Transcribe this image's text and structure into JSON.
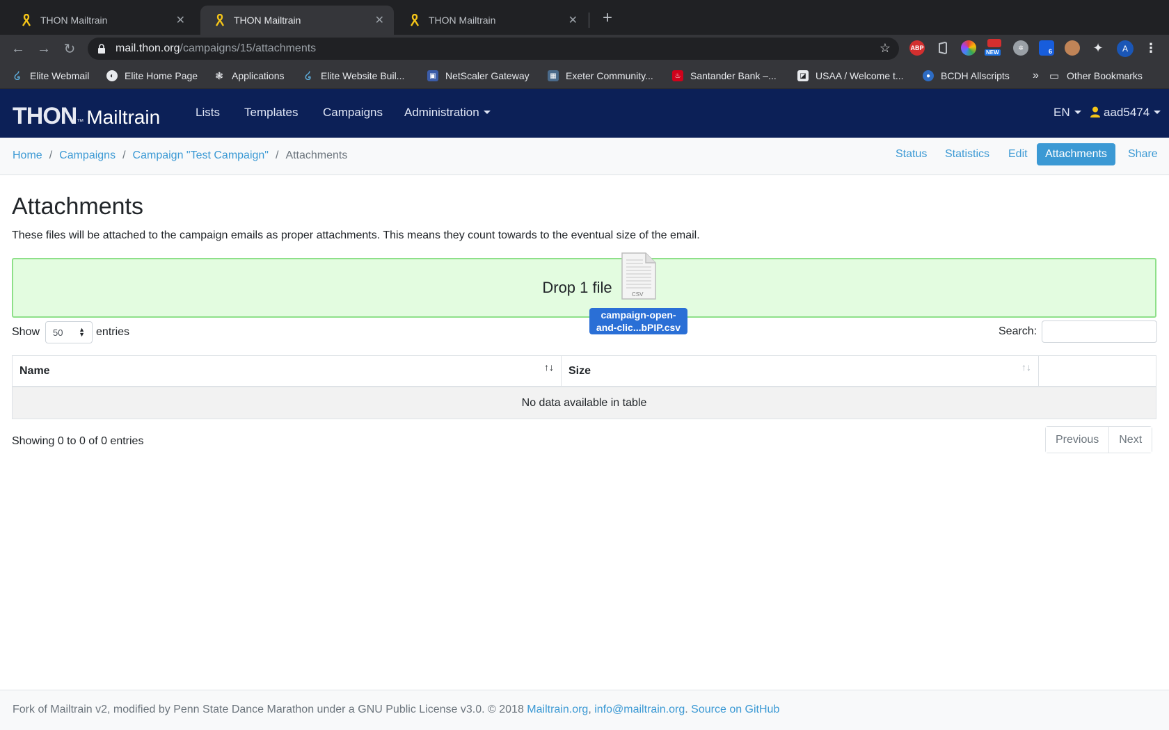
{
  "browser": {
    "tabs": [
      {
        "title": "THON Mailtrain",
        "active": false
      },
      {
        "title": "THON Mailtrain",
        "active": true
      },
      {
        "title": "THON Mailtrain",
        "active": false
      }
    ],
    "url_host": "mail.thon.org",
    "url_path": "/campaigns/15/attachments",
    "extensions": [
      "adblock-icon",
      "office-icon",
      "color-wheel-icon",
      "new-badge-icon",
      "gear-extension-icon",
      "bitwarden-icon",
      "cookie-icon",
      "puzzle-icon",
      "profile-avatar"
    ],
    "extension_badges": {
      "new": "NEW",
      "count": "6",
      "avatar": "A"
    },
    "bookmarks": [
      {
        "label": "Elite Webmail",
        "icon": "swirl-icon"
      },
      {
        "label": "Elite Home Page",
        "icon": "globe-icon"
      },
      {
        "label": "Applications",
        "icon": "brain-icon"
      },
      {
        "label": "Elite Website Buil...",
        "icon": "swirl-icon"
      },
      {
        "label": "NetScaler Gateway",
        "icon": "lock-icon"
      },
      {
        "label": "Exeter Community...",
        "icon": "building-icon"
      },
      {
        "label": "Santander Bank –...",
        "icon": "flame-icon"
      },
      {
        "label": "USAA / Welcome t...",
        "icon": "usaa-icon"
      },
      {
        "label": "BCDH Allscripts",
        "icon": "dell-icon"
      }
    ],
    "bookmarks_overflow": "»",
    "other_bookmarks": "Other Bookmarks"
  },
  "app": {
    "brand_thon": "THON",
    "brand_tm": "™",
    "brand_mailtrain": "Mailtrain",
    "nav": [
      "Lists",
      "Templates",
      "Campaigns",
      "Administration"
    ],
    "language": "EN",
    "user": "aad5474",
    "colors": {
      "navbar": "#0c2057",
      "link": "#3b99d4",
      "dropzone": "#e3fce0",
      "drag_label": "#2a6fd6"
    }
  },
  "breadcrumb": {
    "items": [
      "Home",
      "Campaigns",
      "Campaign \"Test Campaign\""
    ],
    "current": "Attachments"
  },
  "subnav": {
    "items": [
      "Status",
      "Statistics",
      "Edit",
      "Attachments",
      "Share"
    ],
    "active": "Attachments"
  },
  "page": {
    "title": "Attachments",
    "description": "These files will be attached to the campaign emails as proper attachments. This means they count towards to the eventual size of the email.",
    "dropzone_text": "Drop 1 file",
    "dragged_file": {
      "name_line1": "campaign-open-",
      "name_line2": "and-clic...bPIP.csv",
      "badge": "CSV"
    }
  },
  "table": {
    "show_label": "Show",
    "entries_label": "entries",
    "page_length": "50",
    "search_label": "Search:",
    "search_value": "",
    "columns": [
      "Name",
      "Size",
      ""
    ],
    "empty_text": "No data available in table",
    "info": "Showing 0 to 0 of 0 entries",
    "previous": "Previous",
    "next": "Next"
  },
  "footer": {
    "text": "Fork of Mailtrain v2, modified by Penn State Dance Marathon under a GNU Public License v3.0. © 2018 ",
    "link1": "Mailtrain.org",
    "comma": ", ",
    "link2": "info@mailtrain.org",
    "dot": ". ",
    "link3": "Source on GitHub"
  }
}
